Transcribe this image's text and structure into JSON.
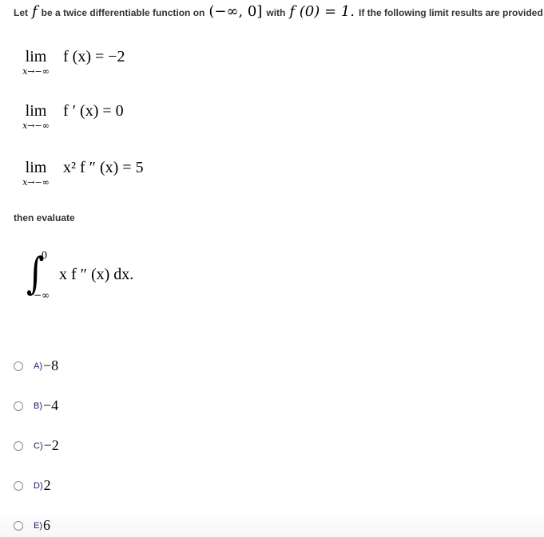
{
  "question": {
    "intro_text": "Let",
    "function_symbol": "f",
    "text_after_f": "be a twice differentiable function on",
    "interval": "(−∞, 0]",
    "text_with": "with",
    "initial_condition": "f (0) = 1.",
    "text_after_condition": "If the following limit results are provided"
  },
  "limits": [
    {
      "operator": "lim",
      "subscript": "x→−∞",
      "expression": "f (x) = −2"
    },
    {
      "operator": "lim",
      "subscript": "x→−∞",
      "expression": "f ′ (x) = 0"
    },
    {
      "operator": "lim",
      "subscript": "x→−∞",
      "expression": "x² f ″ (x) = 5"
    }
  ],
  "then_text": "then evaluate",
  "integral": {
    "symbol": "∫",
    "upper_limit": "0",
    "lower_limit": "−∞",
    "integrand": "x f ″ (x)  dx."
  },
  "options": [
    {
      "label": "A)",
      "value": "−8",
      "selected": false
    },
    {
      "label": "B)",
      "value": "−4",
      "selected": false
    },
    {
      "label": "C)",
      "value": "−2",
      "selected": false
    },
    {
      "label": "D)",
      "value": "2",
      "selected": false
    },
    {
      "label": "E)",
      "value": "6",
      "selected": false
    }
  ]
}
